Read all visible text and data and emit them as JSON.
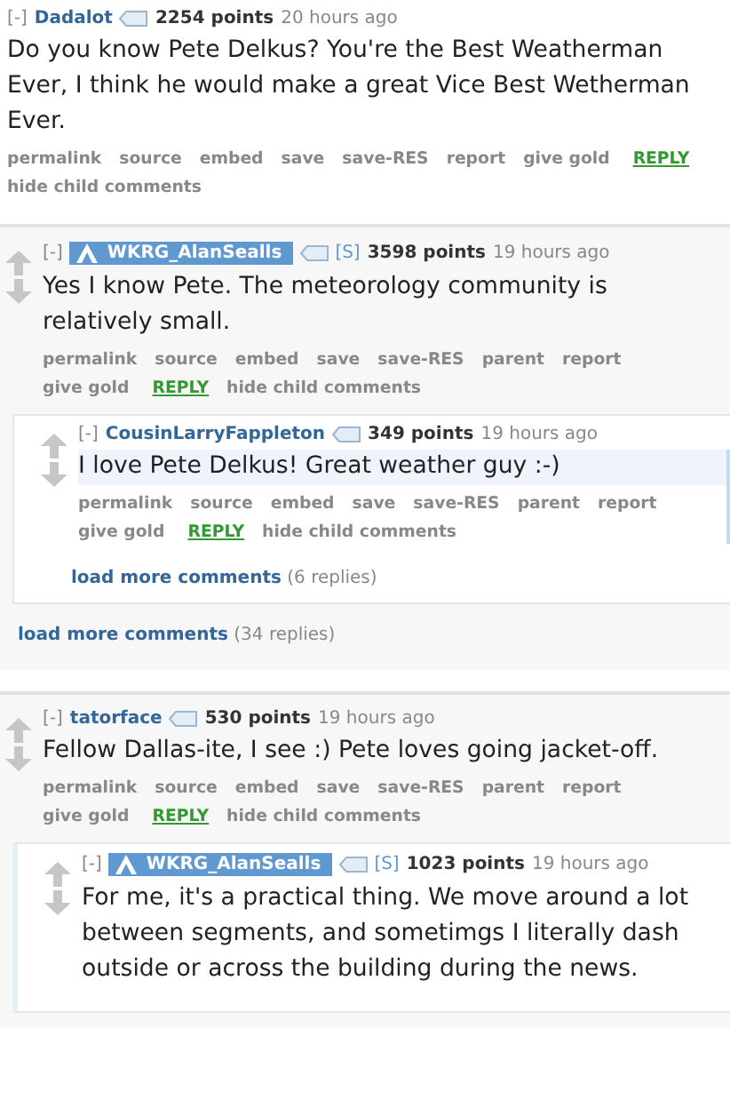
{
  "comments": [
    {
      "collapse": "[-]",
      "author": "Dadalot",
      "submitter": false,
      "arrows": false,
      "points": "2254 points",
      "time": "20 hours ago",
      "body": "Do you know Pete Delkus? You're the Best Weatherman Ever, I think he would make a great Vice Best Wetherman Ever.",
      "actions": [
        {
          "label": "permalink",
          "kind": "link"
        },
        {
          "label": "source",
          "kind": "link"
        },
        {
          "label": "embed",
          "kind": "link"
        },
        {
          "label": "save",
          "kind": "link"
        },
        {
          "label": "save-RES",
          "kind": "link"
        },
        {
          "label": "report",
          "kind": "link"
        },
        {
          "label": "give gold",
          "kind": "link"
        },
        {
          "label": "REPLY",
          "kind": "reply"
        },
        {
          "label": "hide child comments",
          "kind": "link"
        }
      ]
    },
    {
      "collapse": "[-]",
      "author": "WKRG_AlanSealls",
      "submitter": true,
      "tag": "[S]",
      "arrows": true,
      "points": "3598 points",
      "time": "19 hours ago",
      "body": "Yes I know Pete. The meteorology community is relatively small.",
      "actions": [
        {
          "label": "permalink",
          "kind": "link"
        },
        {
          "label": "source",
          "kind": "link"
        },
        {
          "label": "embed",
          "kind": "link"
        },
        {
          "label": "save",
          "kind": "link"
        },
        {
          "label": "save-RES",
          "kind": "link"
        },
        {
          "label": "parent",
          "kind": "link"
        },
        {
          "label": "report",
          "kind": "link"
        },
        {
          "label": "give gold",
          "kind": "link"
        },
        {
          "label": "REPLY",
          "kind": "reply"
        },
        {
          "label": "hide child comments",
          "kind": "link"
        }
      ],
      "children": [
        {
          "collapse": "[-]",
          "author": "CousinLarryFappleton",
          "submitter": false,
          "arrows": true,
          "highlighted": true,
          "points": "349 points",
          "time": "19 hours ago",
          "body": "I love Pete Delkus! Great weather guy :-)",
          "actions": [
            {
              "label": "permalink",
              "kind": "link"
            },
            {
              "label": "source",
              "kind": "link"
            },
            {
              "label": "embed",
              "kind": "link"
            },
            {
              "label": "save",
              "kind": "link"
            },
            {
              "label": "save-RES",
              "kind": "link"
            },
            {
              "label": "parent",
              "kind": "link"
            },
            {
              "label": "report",
              "kind": "link"
            },
            {
              "label": "give gold",
              "kind": "link"
            },
            {
              "label": "REPLY",
              "kind": "reply"
            },
            {
              "label": "hide child comments",
              "kind": "link"
            }
          ],
          "load_more": {
            "label": "load more comments",
            "count": "(6 replies)"
          }
        }
      ],
      "load_more": {
        "label": "load more comments",
        "count": "(34 replies)"
      }
    },
    {
      "collapse": "[-]",
      "author": "tatorface",
      "submitter": false,
      "arrows": true,
      "points": "530 points",
      "time": "19 hours ago",
      "body": "Fellow Dallas-ite, I see :) Pete loves going jacket-off.",
      "actions": [
        {
          "label": "permalink",
          "kind": "link"
        },
        {
          "label": "source",
          "kind": "link"
        },
        {
          "label": "embed",
          "kind": "link"
        },
        {
          "label": "save",
          "kind": "link"
        },
        {
          "label": "save-RES",
          "kind": "link"
        },
        {
          "label": "parent",
          "kind": "link"
        },
        {
          "label": "report",
          "kind": "link"
        },
        {
          "label": "give gold",
          "kind": "link"
        },
        {
          "label": "REPLY",
          "kind": "reply"
        },
        {
          "label": "hide child comments",
          "kind": "link"
        }
      ],
      "children": [
        {
          "collapse": "[-]",
          "author": "WKRG_AlanSealls",
          "submitter": true,
          "tag": "[S]",
          "arrows": true,
          "points": "1023 points",
          "time": "19 hours ago",
          "body": "For me, it's a practical thing. We move around a lot between segments, and sometimgs I literally dash outside or across the building during the news."
        }
      ]
    }
  ]
}
